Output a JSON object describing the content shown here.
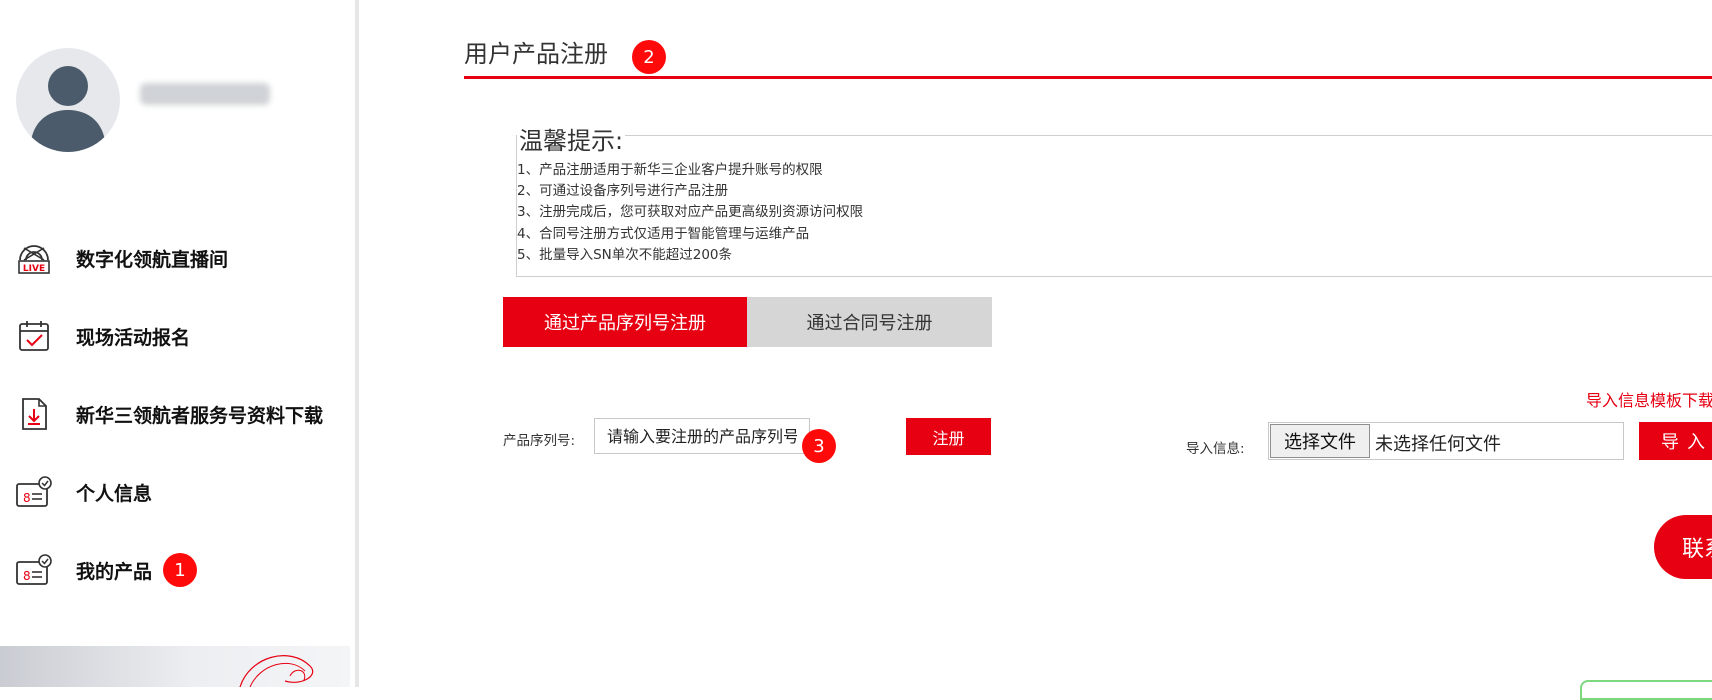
{
  "sidebar": {
    "items": [
      {
        "label": "数字化领航直播间",
        "icon": "live-broadcast-icon"
      },
      {
        "label": "现场活动报名",
        "icon": "calendar-check-icon"
      },
      {
        "label": "新华三领航者服务号资料下载",
        "icon": "file-download-icon"
      },
      {
        "label": "个人信息",
        "icon": "id-card-icon"
      },
      {
        "label": "我的产品",
        "icon": "id-card-icon",
        "badge": "1"
      }
    ]
  },
  "main": {
    "title": "用户产品注册",
    "title_badge": "2",
    "notice": {
      "title": "温馨提示:",
      "lines": [
        "1、产品注册适用于新华三企业客户提升账号的权限",
        "2、可通过设备序列号进行产品注册",
        "3、注册完成后，您可获取对应产品更高级别资源访问权限",
        "4、合同号注册方式仅适用于智能管理与运维产品",
        "5、批量导入SN单次不能超过200条"
      ]
    },
    "tabs": [
      {
        "label": "通过产品序列号注册",
        "active": true
      },
      {
        "label": "通过合同号注册",
        "active": false
      }
    ],
    "serial_form": {
      "label": "产品序列号:",
      "placeholder": "请输入要注册的产品序列号SN",
      "value": "",
      "badge": "3",
      "submit_label": "注册"
    },
    "import": {
      "template_link": "导入信息模板下载",
      "label": "导入信息:",
      "choose_file_label": "选择文件",
      "file_status": "未选择任何文件",
      "import_label": "导入"
    },
    "contact_label": "联系"
  },
  "colors": {
    "accent": "#e60012",
    "badge": "#ff0a0a",
    "tab_inactive": "#d6d6d6"
  }
}
